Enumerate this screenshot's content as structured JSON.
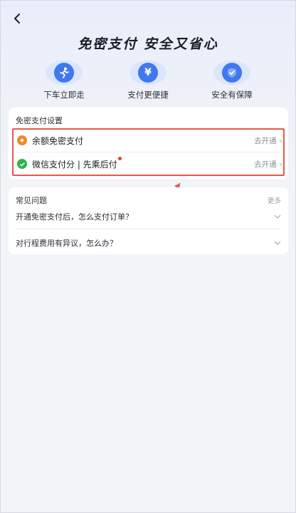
{
  "nav": {
    "back_icon": "back-arrow-icon"
  },
  "hero": {
    "title": "免密支付 安全又省心"
  },
  "features": [
    {
      "label": "下车立即走",
      "icon": "running-person-icon"
    },
    {
      "label": "支付更便捷",
      "icon": "yen-coin-icon"
    },
    {
      "label": "安全有保障",
      "icon": "shield-check-icon"
    }
  ],
  "settings": {
    "title": "免密支付设置",
    "items": [
      {
        "label": "余额免密支付",
        "action": "去开通",
        "icon": "balance-wallet-icon",
        "icon_color": "#f08a2a"
      },
      {
        "label": "微信支付分 | 先乘后付",
        "action": "去开通",
        "icon": "wechat-pay-icon",
        "icon_color": "#2fb34b",
        "has_dot": true
      }
    ],
    "highlight_color": "#e6594a"
  },
  "faq": {
    "title": "常见问题",
    "more": "更多",
    "items": [
      {
        "question": "开通免密支付后，怎么支付订单？"
      },
      {
        "question": "对行程费用有异议，怎么办？"
      }
    ]
  },
  "colors": {
    "accent": "#3f78f0",
    "annotation": "#e6594a"
  }
}
